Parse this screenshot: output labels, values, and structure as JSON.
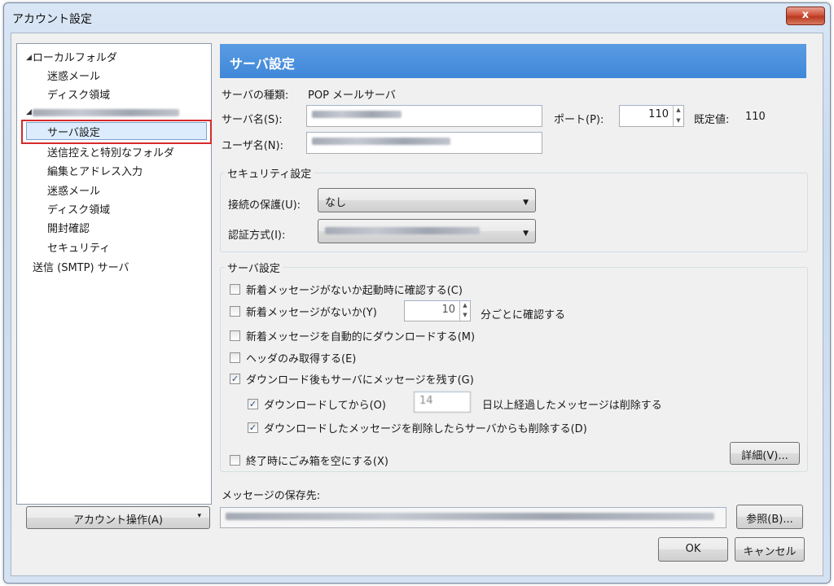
{
  "window": {
    "title": "アカウント設定",
    "close_glyph": "x"
  },
  "tree": {
    "local_folders": "ローカルフォルダ",
    "local_junk": "迷惑メール",
    "local_disk": "ディスク領域",
    "server_settings": "サーバ設定",
    "copies_folders": "送信控えと特別なフォルダ",
    "composition": "編集とアドレス入力",
    "junk": "迷惑メール",
    "disk": "ディスク領域",
    "return_receipts": "開封確認",
    "security": "セキュリティ",
    "smtp": "送信 (SMTP) サーバ"
  },
  "account_actions_button": "アカウント操作(A)",
  "panel": {
    "header": "サーバ設定",
    "server_type_label": "サーバの種類:",
    "server_type_value": "POP メールサーバ",
    "server_name_label": "サーバ名(S):",
    "port_label": "ポート(P):",
    "port_value": "110",
    "default_label": "既定値:",
    "default_value": "110",
    "username_label": "ユーザ名(N):"
  },
  "security": {
    "group_title": "セキュリティ設定",
    "connection_label": "接続の保護(U):",
    "connection_value": "なし",
    "auth_label": "認証方式(I):"
  },
  "server": {
    "group_title": "サーバ設定",
    "check_startup": "新着メッセージがないか起動時に確認する(C)",
    "check_every": "新着メッセージがないか(Y)",
    "check_every_minutes": "10",
    "check_every_suffix": "分ごとに確認する",
    "auto_download": "新着メッセージを自動的にダウンロードする(M)",
    "headers_only": "ヘッダのみ取得する(E)",
    "leave_on_server": "ダウンロード後もサーバにメッセージを残す(G)",
    "delete_after_prefix": "ダウンロードしてから(O)",
    "delete_after_days": "14",
    "delete_after_suffix": "日以上経過したメッセージは削除する",
    "delete_on_server": "ダウンロードしたメッセージを削除したらサーバからも削除する(D)",
    "empty_trash": "終了時にごみ箱を空にする(X)",
    "advanced_button": "詳細(V)..."
  },
  "storage": {
    "label": "メッセージの保存先:",
    "browse_button": "参照(B)..."
  },
  "footer": {
    "ok": "OK",
    "cancel": "キャンセル"
  },
  "checked": {
    "check_startup": false,
    "check_every": false,
    "auto_download": false,
    "headers_only": false,
    "leave_on_server": true,
    "delete_after": true,
    "delete_on_server": true,
    "empty_trash": false
  }
}
